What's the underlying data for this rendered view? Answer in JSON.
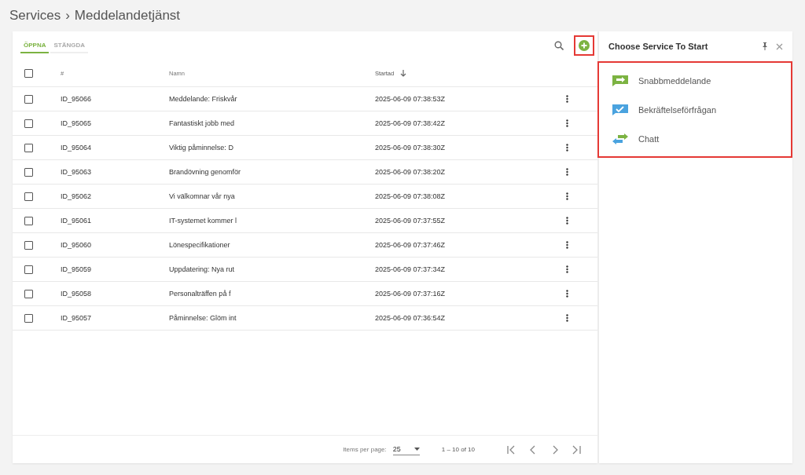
{
  "breadcrumb": {
    "parent": "Services",
    "separator": "›",
    "current": "Meddelandetjänst"
  },
  "tabs": [
    {
      "label": "ÖPPNA",
      "selected": true
    },
    {
      "label": "STÄNGDA",
      "selected": false
    }
  ],
  "toolbar": {
    "add_button_highlighted": true
  },
  "table": {
    "columns": [
      {
        "label": "#",
        "sorted": false
      },
      {
        "label": "Namn",
        "sorted": false
      },
      {
        "label": "Startad",
        "sorted": true
      }
    ],
    "all_checked": false,
    "rows": [
      {
        "id": "ID_95066",
        "name": "Meddelande: Friskvår",
        "started": "2025-06-09 07:38:53Z",
        "checked": false
      },
      {
        "id": "ID_95065",
        "name": "Fantastiskt jobb med",
        "started": "2025-06-09 07:38:42Z",
        "checked": false
      },
      {
        "id": "ID_95064",
        "name": "Viktig påminnelse: D",
        "started": "2025-06-09 07:38:30Z",
        "checked": false
      },
      {
        "id": "ID_95063",
        "name": "Brandövning genomför",
        "started": "2025-06-09 07:38:20Z",
        "checked": false
      },
      {
        "id": "ID_95062",
        "name": "Vi välkomnar vår nya",
        "started": "2025-06-09 07:38:08Z",
        "checked": false
      },
      {
        "id": "ID_95061",
        "name": "IT-systemet kommer l",
        "started": "2025-06-09 07:37:55Z",
        "checked": false
      },
      {
        "id": "ID_95060",
        "name": "Lönespecifikationer",
        "started": "2025-06-09 07:37:46Z",
        "checked": false
      },
      {
        "id": "ID_95059",
        "name": "Uppdatering: Nya rut",
        "started": "2025-06-09 07:37:34Z",
        "checked": false
      },
      {
        "id": "ID_95058",
        "name": "Personalträffen på f",
        "started": "2025-06-09 07:37:16Z",
        "checked": false
      },
      {
        "id": "ID_95057",
        "name": "Påminnelse: Glöm int",
        "started": "2025-06-09 07:36:54Z",
        "checked": false
      }
    ]
  },
  "paginator": {
    "items_per_page_label": "Items per page:",
    "items_per_page": "25",
    "range": "1 – 10 of 10"
  },
  "side_panel": {
    "title": "Choose Service To Start",
    "list_highlighted": true,
    "services": [
      {
        "kind": "arrow",
        "label": "Snabbmeddelande"
      },
      {
        "kind": "check",
        "label": "Bekräftelseförfrågan"
      },
      {
        "kind": "swap",
        "label": "Chatt"
      }
    ]
  }
}
